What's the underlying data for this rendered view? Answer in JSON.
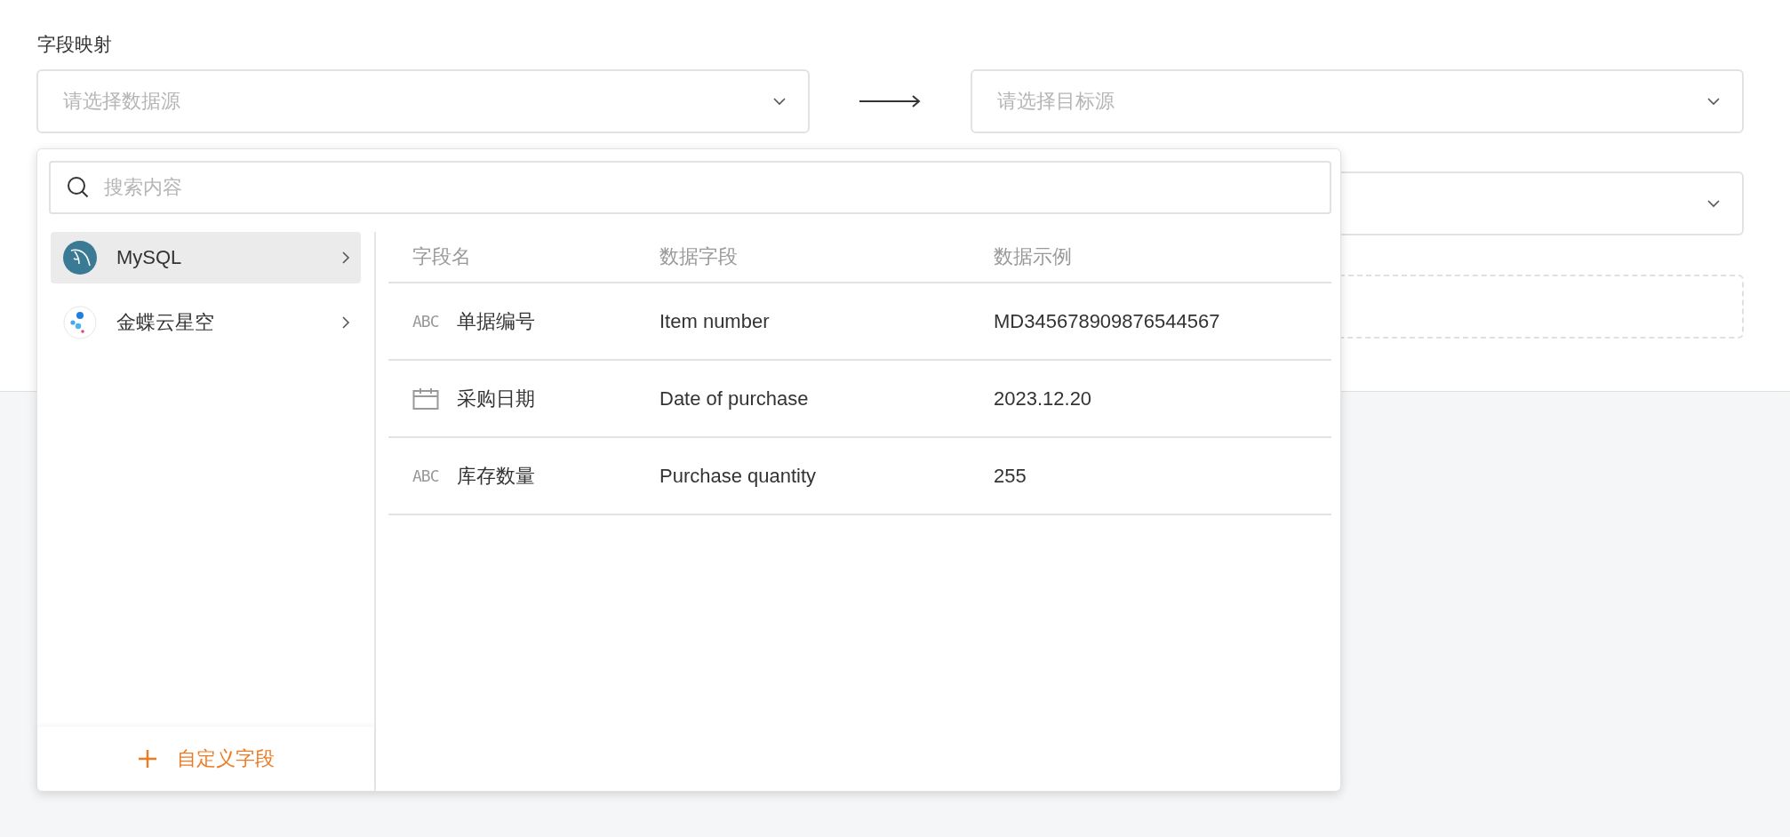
{
  "form": {
    "label": "字段映射",
    "source_select": {
      "placeholder": "请选择数据源"
    },
    "target_select": {
      "placeholder": "请选择目标源"
    }
  },
  "dropdown": {
    "search": {
      "placeholder": "搜索内容"
    },
    "sources": [
      {
        "name": "MySQL",
        "kind": "mysql",
        "selected": true
      },
      {
        "name": "金蝶云星空",
        "kind": "kingdee",
        "selected": false
      }
    ],
    "custom_field_button": {
      "label": "自定义字段"
    },
    "fields_table": {
      "columns": [
        "字段名",
        "数据字段",
        "数据示例"
      ],
      "rows": [
        {
          "kind": "text",
          "type_label": "ABC",
          "name": "单据编号",
          "field": "Item number",
          "example": "MD345678909876544567"
        },
        {
          "kind": "date",
          "name": "采购日期",
          "field": "Date of purchase",
          "example": "2023.12.20"
        },
        {
          "kind": "text",
          "type_label": "ABC",
          "name": "库存数量",
          "field": "Purchase quantity",
          "example": "255"
        }
      ]
    }
  }
}
